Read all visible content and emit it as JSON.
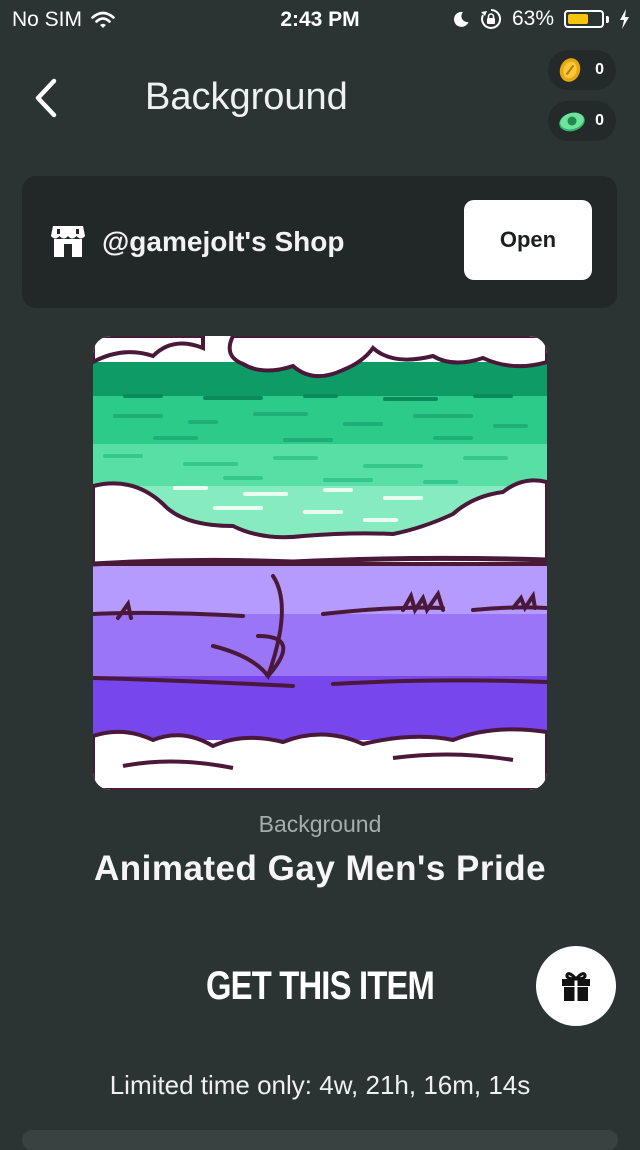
{
  "status_bar": {
    "carrier": "No SIM",
    "time": "2:43 PM",
    "battery_percent": "63%",
    "battery_level": 0.63,
    "icons": [
      "wifi-icon",
      "moon-icon",
      "rotation-lock-icon",
      "battery-icon",
      "charging-icon"
    ]
  },
  "header": {
    "title": "Background",
    "back_icon": "chevron-left-icon"
  },
  "currency": {
    "coins": "0",
    "cash": "0",
    "coin_icon": "coin-icon",
    "cash_icon": "cash-icon"
  },
  "shop": {
    "name": "@gamejolt's Shop",
    "open_label": "Open",
    "icon": "store-icon"
  },
  "item": {
    "type": "Background",
    "name": "Animated Gay Men's Pride",
    "get_label": "GET THIS ITEM",
    "limited_text": "Limited time only: 4w, 21h, 16m, 14s",
    "gift_icon": "gift-icon"
  },
  "colors": {
    "background": "#2c3333",
    "card": "#222828",
    "battery": "#f6c40a",
    "green_dark": "#0e9b66",
    "green": "#2ccb89",
    "green_light": "#86ecc0",
    "purple_light": "#b69bff",
    "purple": "#9a76f7",
    "purple_dark": "#7746ec",
    "outline": "#4a1838"
  }
}
